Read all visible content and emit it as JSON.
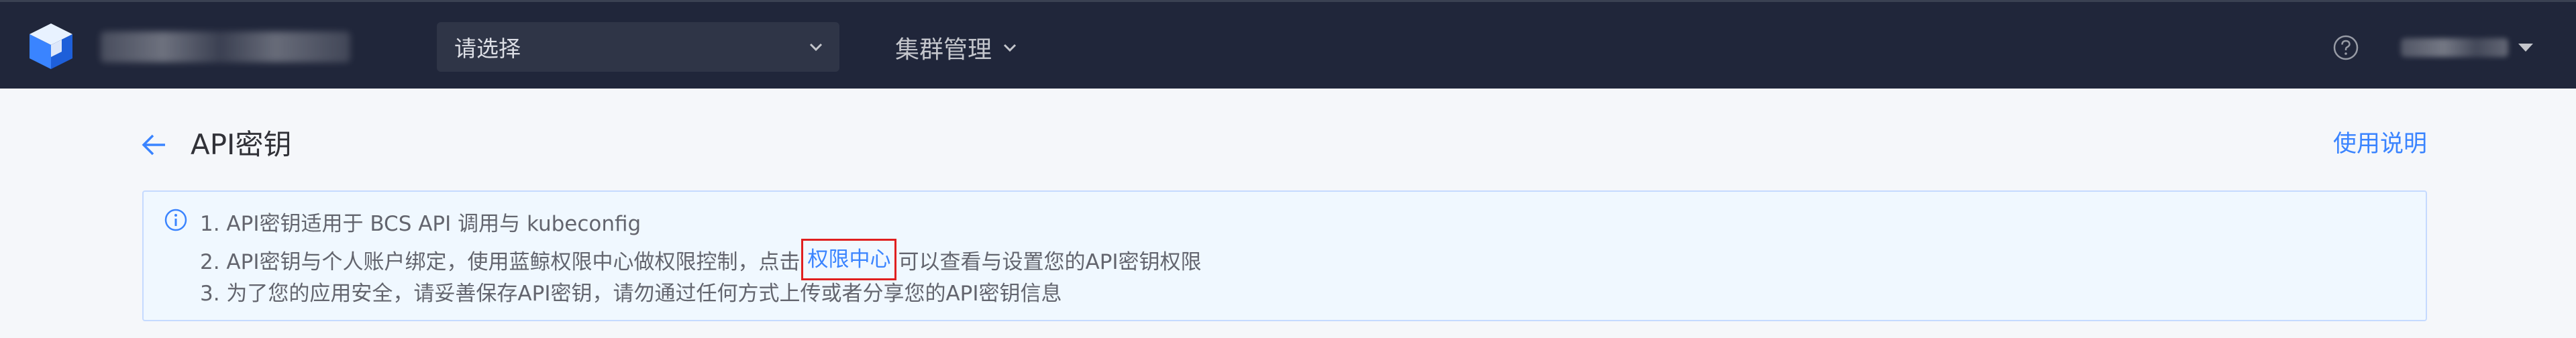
{
  "header": {
    "project_select": {
      "value": "请选择"
    },
    "nav_menu": {
      "label": "集群管理"
    },
    "colors": {
      "background": "#20263a",
      "select_bg": "#2f3547"
    }
  },
  "page": {
    "title": "API密钥",
    "help_link": "使用说明"
  },
  "notice": {
    "line1": "1. API密钥适用于 BCS API 调用与 kubeconfig",
    "line2_before": "2. API密钥与个人账户绑定，使用蓝鲸权限中心做权限控制，点击",
    "line2_link": "权限中心",
    "line2_after": "可以查看与设置您的API密钥权限",
    "line3": "3. 为了您的应用安全，请妥善保存API密钥，请勿通过任何方式上传或者分享您的API密钥信息"
  },
  "colors": {
    "accent": "#3a84ff",
    "notice_bg": "#f0f8ff",
    "highlight_border": "#e02020"
  },
  "icons": {
    "logo": "cube-logo-icon",
    "select_chevron": "chevron-down-icon",
    "menu_chevron": "chevron-down-icon",
    "help": "question-circle-icon",
    "user_caret": "caret-down-icon",
    "back": "arrow-left-icon",
    "info": "info-circle-icon"
  }
}
